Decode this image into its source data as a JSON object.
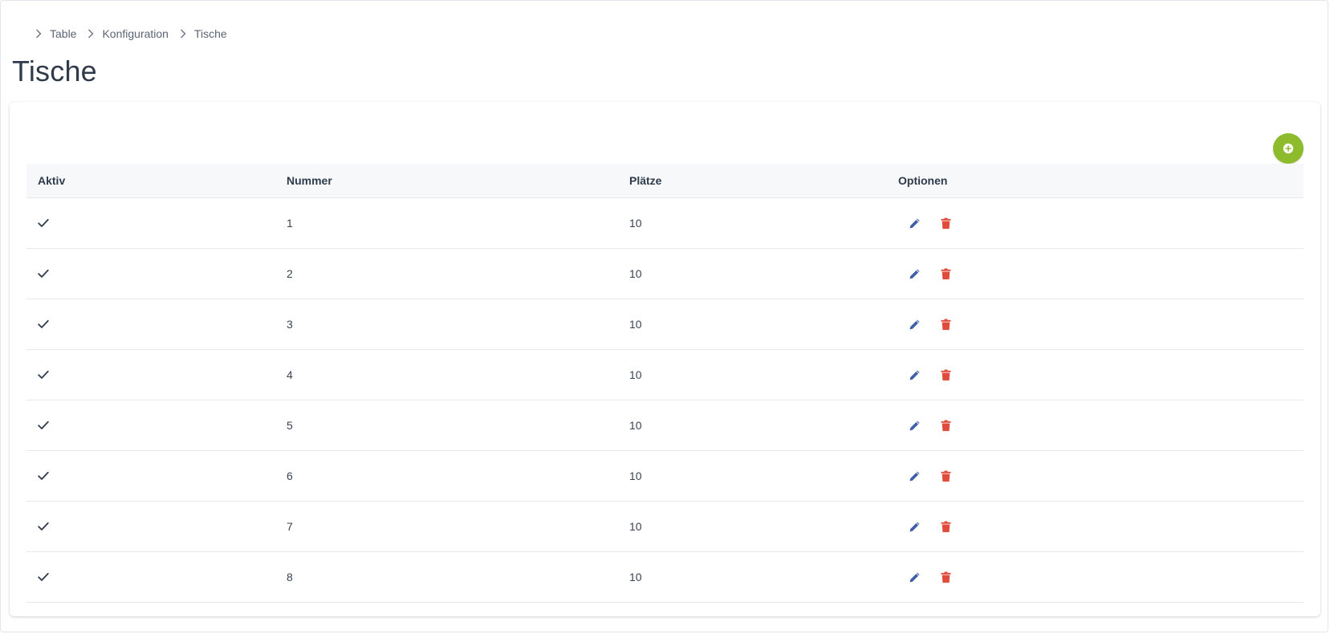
{
  "breadcrumb": {
    "items": [
      "Table",
      "Konfiguration",
      "Tische"
    ]
  },
  "page": {
    "title": "Tische"
  },
  "colors": {
    "accent_green": "#8dbb2c",
    "edit_blue": "#3f5fa8",
    "delete_red": "#e04b3c"
  },
  "table": {
    "headers": {
      "aktiv": "Aktiv",
      "nummer": "Nummer",
      "plaetze": "Plätze",
      "optionen": "Optionen"
    },
    "rows": [
      {
        "aktiv": true,
        "nummer": "1",
        "plaetze": "10"
      },
      {
        "aktiv": true,
        "nummer": "2",
        "plaetze": "10"
      },
      {
        "aktiv": true,
        "nummer": "3",
        "plaetze": "10"
      },
      {
        "aktiv": true,
        "nummer": "4",
        "plaetze": "10"
      },
      {
        "aktiv": true,
        "nummer": "5",
        "plaetze": "10"
      },
      {
        "aktiv": true,
        "nummer": "6",
        "plaetze": "10"
      },
      {
        "aktiv": true,
        "nummer": "7",
        "plaetze": "10"
      },
      {
        "aktiv": true,
        "nummer": "8",
        "plaetze": "10"
      }
    ]
  },
  "icons": {
    "aktiv": "check-icon",
    "edit": "pencil-icon",
    "delete": "trash-icon",
    "add": "plus-circle-icon",
    "breadcrumb_separator": "chevron-right-icon"
  }
}
